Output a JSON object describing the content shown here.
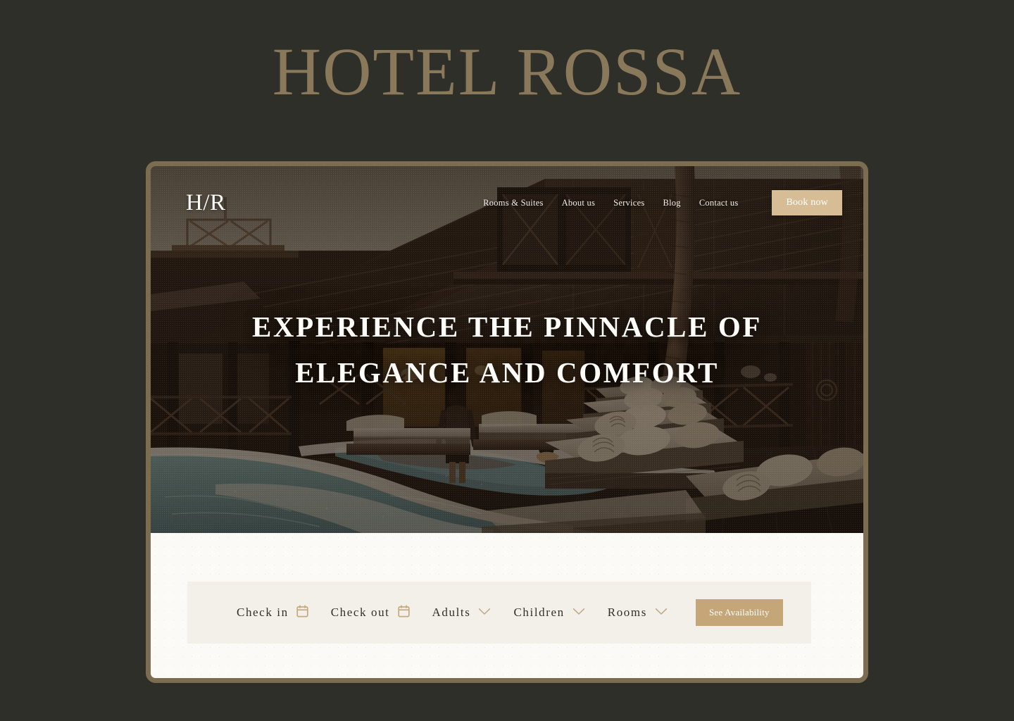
{
  "brand": {
    "wordmark": "HOTEL ROSSA",
    "wordmark_color": "#8a785a",
    "logo": "H/R"
  },
  "frame": {
    "border_color": "#7d6d50",
    "page_background": "#2f2f29",
    "panel_background": "#fbfaf7"
  },
  "nav": {
    "items": [
      {
        "label": "Rooms & Suites"
      },
      {
        "label": "About us"
      },
      {
        "label": "Services"
      },
      {
        "label": "Blog"
      },
      {
        "label": "Contact us"
      }
    ],
    "cta": {
      "label": "Book now",
      "background": "#d6bd96",
      "text_color": "#ffffff"
    }
  },
  "hero": {
    "headline": "EXPERIENCE THE PINNACLE OF ELEGANCE AND COMFORT",
    "headline_color": "#fffdf9",
    "scene": "tropical resort pavilion with swimming pool at dusk, wooden sun loungers with cream cushions and palm-print pillows, shingled gable roof, palm trunks"
  },
  "booking": {
    "background": "#f2f0e9",
    "fields": [
      {
        "label": "Check in",
        "icon": "calendar-icon",
        "type": "date"
      },
      {
        "label": "Check out",
        "icon": "calendar-icon",
        "type": "date"
      },
      {
        "label": "Adults",
        "icon": "chevron-down-icon",
        "type": "select"
      },
      {
        "label": "Children",
        "icon": "chevron-down-icon",
        "type": "select"
      },
      {
        "label": "Rooms",
        "icon": "chevron-down-icon",
        "type": "select"
      }
    ],
    "submit": {
      "label": "See Availability",
      "background": "#c4a678",
      "text_color": "#ffffff"
    }
  }
}
